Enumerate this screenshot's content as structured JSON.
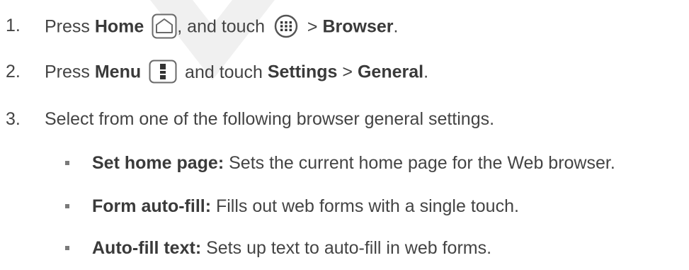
{
  "steps": [
    {
      "number": "1.",
      "press": "Press",
      "home": "Home",
      "middle": ", and touch",
      "sep": ">",
      "browser": "Browser",
      "end": ".",
      "icons": [
        "home-button-icon",
        "apps-launcher-icon"
      ]
    },
    {
      "number": "2.",
      "press": "Press",
      "menu": "Menu",
      "middle": "and touch",
      "settings": "Settings",
      "sep": ">",
      "general": "General",
      "end": ".",
      "icons": [
        "menu-button-icon"
      ]
    },
    {
      "number": "3.",
      "text": "Select from one of the following browser general settings."
    }
  ],
  "bullets": [
    {
      "term": "Set home page:",
      "desc": "Sets the current home page for the Web browser."
    },
    {
      "term": "Form auto-fill:",
      "desc": "Fills out web forms with a single touch."
    },
    {
      "term": "Auto-fill text:",
      "desc": "Sets up text to auto-fill in web forms."
    }
  ],
  "colors": {
    "text": "#444444",
    "watermark": "#f0f0f0"
  }
}
